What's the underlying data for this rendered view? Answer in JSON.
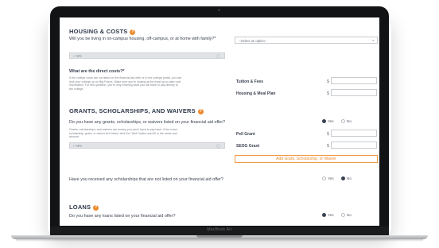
{
  "device": {
    "brand": "MacBook Air"
  },
  "housing": {
    "title": "HOUSING & COSTS",
    "question": "Will you be living in on-campus housing, off-campus, or at home with family?*",
    "select_placeholder": "--Select an option--",
    "tips_label": "TIPS",
    "direct_costs_title": "What are the direct costs?*",
    "direct_costs_help_1": "If the college costs are not listed on the financial aid offer or in the college portal, you can",
    "direct_costs_help_2": "look your college up on Big Future. Make sure you're looking at the most up-to-date cost",
    "direct_costs_help_3": "information. For this question, you're only entering what you will have to pay directly to",
    "direct_costs_help_4": "the college.",
    "tuition_label": "Tuition & Fees",
    "housing_label": "Housing & Meal Plan",
    "currency_symbol": "$"
  },
  "grants": {
    "title": "GRANTS, SCHOLARSHIPS, AND WAIVERS",
    "question": "Do you have any grants, scholarships, or waivers listed on your financial aid offer?",
    "help_1": "Grants, scholarships, and waivers are money you won't have to pay back. If the exact",
    "help_2": "scholarship, grant, or waiver isn't listed, click the \"Add\" button and fill in the name and",
    "help_3": "amount.",
    "tips_label": "TIPS",
    "yes_label": "Yes",
    "no_label": "No",
    "selected": "Yes",
    "pell_label": "Pell Grant",
    "seog_label": "SEOG Grant",
    "add_button": "Add Grant, Scholarship, or Waiver",
    "currency_symbol": "$"
  },
  "scholarships": {
    "question": "Have you received any scholarships that are not listed on your financial aid offer?",
    "yes_label": "Yes",
    "no_label": "No",
    "selected": "No"
  },
  "loans": {
    "title": "LOANS",
    "question": "Do you have any loans listed on your financial aid offer?",
    "yes_label": "Yes",
    "no_label": "No",
    "selected": "Yes"
  },
  "colors": {
    "accent": "#ee8a2c",
    "heading": "#2f3a4a",
    "tips_bg": "#e1e3e7"
  }
}
